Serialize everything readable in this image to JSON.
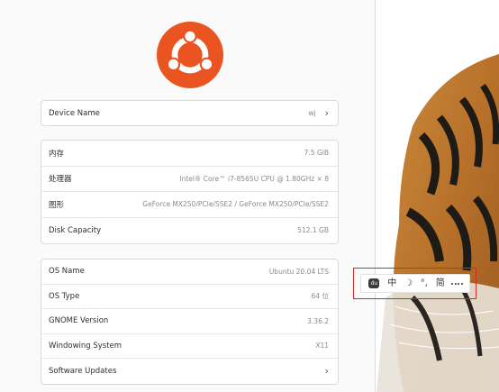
{
  "device": {
    "label": "Device Name",
    "value": "wj",
    "chevron": "›"
  },
  "hardware": [
    {
      "label": "内存",
      "value": "7.5 GiB"
    },
    {
      "label": "处理器",
      "value": "Intel® Core™ i7-8565U CPU @ 1.80GHz × 8"
    },
    {
      "label": "图形",
      "value": "GeForce MX250/PCIe/SSE2 / GeForce MX250/PCIe/SSE2"
    },
    {
      "label": "Disk Capacity",
      "value": "512.1 GB"
    }
  ],
  "os": [
    {
      "label": "OS Name",
      "value": "Ubuntu 20.04 LTS"
    },
    {
      "label": "OS Type",
      "value": "64 位"
    },
    {
      "label": "GNOME Version",
      "value": "3.36.2"
    },
    {
      "label": "Windowing System",
      "value": "X11"
    },
    {
      "label": "Software Updates",
      "value": "›"
    }
  ],
  "ime": {
    "logo_icon": "du",
    "mode": "中",
    "moon_icon": "☽",
    "punct_icon": "°,",
    "simplified": "简",
    "grid_icon": "grid-icon"
  },
  "colors": {
    "ubuntu_orange": "#E95420",
    "ime_highlight": "#D62A2A"
  }
}
